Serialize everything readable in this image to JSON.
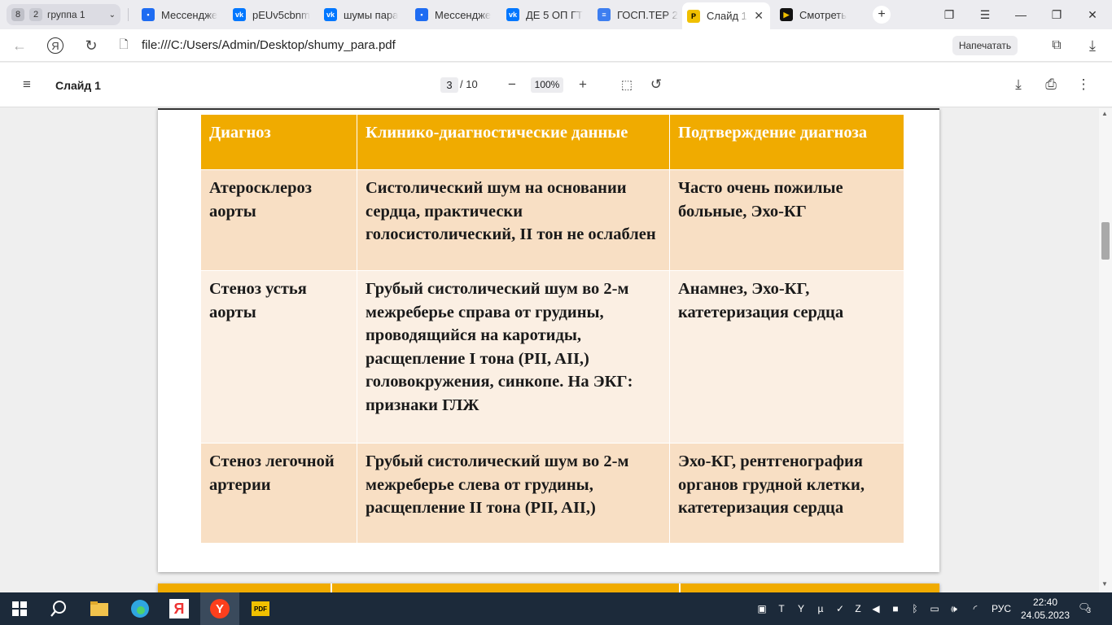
{
  "browser": {
    "tab_group": {
      "count": "8",
      "number": "2",
      "label": "группа 1"
    },
    "tabs": [
      {
        "title": "Мессендже",
        "icon": "messenger-icon"
      },
      {
        "title": "pEUv5cbnm",
        "icon": "vk-icon"
      },
      {
        "title": "шумы пара",
        "icon": "vk-icon"
      },
      {
        "title": "Мессендже",
        "icon": "messenger-icon"
      },
      {
        "title": "ДЕ 5 ОП ГТ",
        "icon": "vk-icon"
      },
      {
        "title": "ГОСП.ТЕР 2",
        "icon": "docs-icon"
      },
      {
        "title": "Слайд 1",
        "icon": "pdf-icon",
        "active": true
      },
      {
        "title": "Смотреть",
        "icon": "video-icon"
      }
    ],
    "address": "file:///C:/Users/Admin/Desktop/shumy_para.pdf",
    "print_button": "Напечатать"
  },
  "pdf": {
    "title": "Слайд 1",
    "page_current": "3",
    "page_total": "/ 10",
    "zoom": "100%"
  },
  "slide": {
    "headers": [
      "Диагноз",
      "Клинико-диагностические данные",
      "Подтверждение диагноза"
    ],
    "rows": [
      [
        "Атеросклероз аорты",
        "Систолический шум на основании сердца, практически голосистолический, II тон не ослаблен",
        "Часто очень пожилые больные, Эхо-КГ"
      ],
      [
        "Стеноз устья аорты",
        "Грубый систолический шум во 2-м межреберье  справа от грудины, проводящийся на каротиды, расщепление I тона (PII, AII,) головокружения, синкопе. На  ЭКГ: признаки ГЛЖ",
        "Анамнез, Эхо-КГ, катетеризация сердца"
      ],
      [
        "Стеноз легочной артерии",
        "Грубый систолический шум во 2-м межреберье слева от грудины, расщепление II тона (PII, AII,)",
        "Эхо-КГ, рентгенография органов грудной клетки, катетеризация сердца"
      ]
    ]
  },
  "taskbar": {
    "lang": "РУС",
    "time": "22:40",
    "date": "24.05.2023",
    "notifications": "3"
  },
  "colors": {
    "header": "#f0ab00",
    "row_odd": "#f8dfc4",
    "row_even": "#fbefe3",
    "taskbar": "#1c2a3a"
  }
}
